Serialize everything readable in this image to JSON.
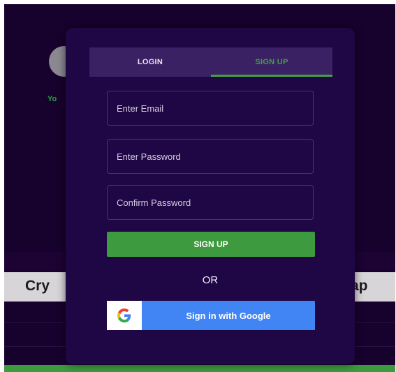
{
  "background": {
    "fragment_text": "Yo",
    "bar_left_text": "Cry",
    "bar_right_text": "ap"
  },
  "modal": {
    "tabs": {
      "login_label": "LOGIN",
      "signup_label": "SIGN UP",
      "active": "SIGN UP"
    },
    "fields": {
      "email_placeholder": "Enter Email",
      "password_placeholder": "Enter Password",
      "confirm_placeholder": "Confirm Password"
    },
    "signup_button_label": "SIGN UP",
    "separator": "OR",
    "google_button_label": "Sign in with Google",
    "google_icon": "google-g-icon"
  },
  "colors": {
    "accent_green": "#3e9a3e",
    "google_blue": "#4184f3",
    "modal_bg": "#1f0645"
  }
}
